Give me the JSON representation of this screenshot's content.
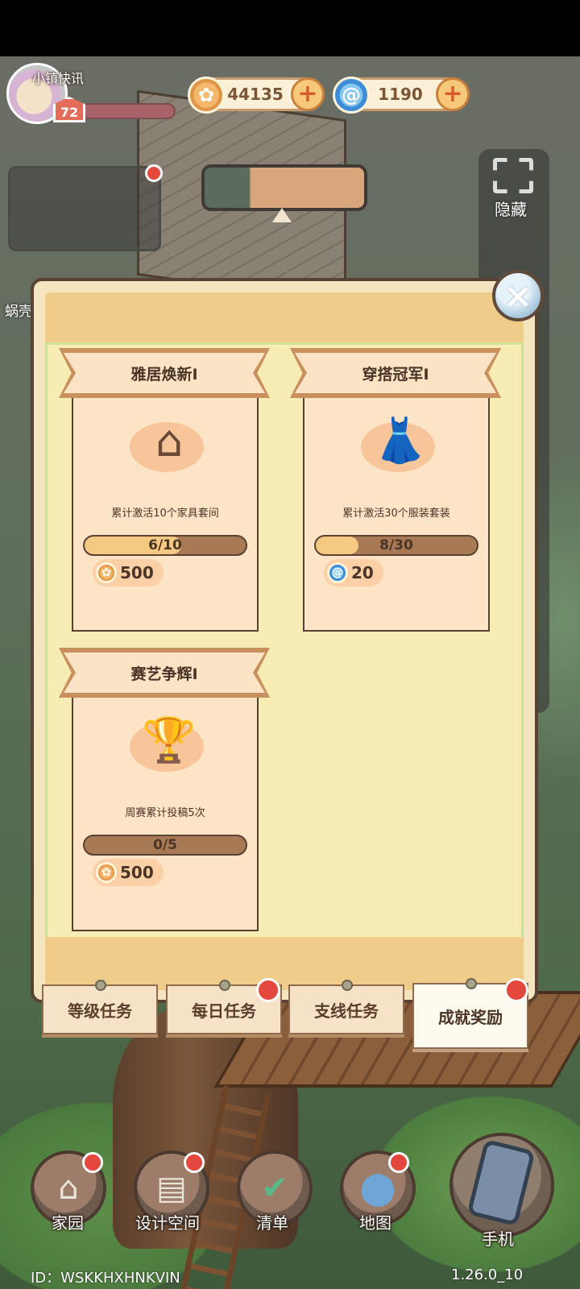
{
  "hud": {
    "level": "72",
    "coins": "44135",
    "gems": "1190",
    "plus": "+"
  },
  "overlay": {
    "town_news": "小镇快讯",
    "hide": "隐藏",
    "snail_partial": "蜗壳"
  },
  "dialog": {
    "close": "×",
    "cards": [
      {
        "title": "雅居焕新Ⅰ",
        "icon": "house-furniture-icon",
        "desc": "累计激活10个家具套间",
        "progress_text": "6/10",
        "progress": 0.6,
        "reward_icon": "coin-icon",
        "reward": "500"
      },
      {
        "title": "穿搭冠军Ⅰ",
        "icon": "outfit-icon",
        "desc": "累计激活30个服装套装",
        "progress_text": "8/30",
        "progress": 0.267,
        "reward_icon": "gem-icon",
        "reward": "20"
      },
      {
        "title": "赛艺争辉Ⅰ",
        "icon": "trophy-icon",
        "desc": "周赛累计投稿5次",
        "progress_text": "0/5",
        "progress": 0,
        "reward_icon": "coin-icon",
        "reward": "500"
      }
    ]
  },
  "tabs": [
    {
      "label": "等级任务",
      "badge": false
    },
    {
      "label": "每日任务",
      "badge": true
    },
    {
      "label": "支线任务",
      "badge": false
    },
    {
      "label": "成就奖励",
      "badge": true,
      "active": true
    }
  ],
  "nav": [
    {
      "label": "家园",
      "icon": "home-icon",
      "badge": true
    },
    {
      "label": "设计空间",
      "icon": "design-icon",
      "badge": true
    },
    {
      "label": "清单",
      "icon": "checklist-icon",
      "badge": false
    },
    {
      "label": "地图",
      "icon": "map-pin-icon",
      "badge": true
    },
    {
      "label": "手机",
      "icon": "phone-icon",
      "badge": false
    }
  ],
  "footer": {
    "id_text": "ID：WSKKHXHNKVIN",
    "version": "1.26.0_10"
  },
  "colors": {
    "dialog_bg": "#f7ecb4",
    "card_bg": "#fde4c6",
    "progress_fill": "#f6c983",
    "badge_red": "#e4483c"
  }
}
